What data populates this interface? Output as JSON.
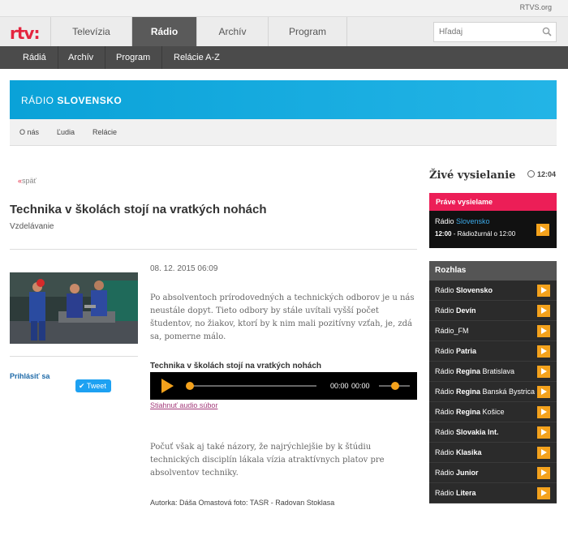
{
  "header": {
    "rtvs_link": "RTVS.org",
    "logo": "rtv:",
    "tabs": [
      {
        "label": "Televízia",
        "active": false
      },
      {
        "label": "Rádio",
        "active": true
      },
      {
        "label": "Archív",
        "active": false
      },
      {
        "label": "Program",
        "active": false
      }
    ],
    "search_placeholder": "Hľadaj"
  },
  "subnav": [
    "Rádiá",
    "Archív",
    "Program",
    "Relácie A-Z"
  ],
  "station_banner": {
    "prefix": "RÁDIO",
    "name": "SLOVENSKO"
  },
  "station_nav": [
    "O nás",
    "Ľudia",
    "Relácie"
  ],
  "article": {
    "back_arrow": "«",
    "back_label": "späť",
    "title": "Technika v školách stojí na vratkých nohách",
    "category": "Vzdelávanie",
    "date": "08. 12. 2015 06:09",
    "paragraph1": "Po absolventoch prírodovedných a technických odborov je u nás neustále dopyt. Tieto odbory by stále uvítali vyšší počet študentov, no žiakov, ktorí by k nim mali pozitívny vzťah, je, zdá sa, pomerne málo.",
    "audio_title": "Technika v školách stojí na vratkých nohách",
    "audio_time_current": "00:00",
    "audio_time_total": "00:00",
    "download_label": "Stiahnuť audio súbor",
    "paragraph2": "Počuť však aj také názory, že najrýchlejšie by k štúdiu technických disciplín lákala vízia atraktívnych platov pre absolventov techniky.",
    "author": "Autorka: Dáša Omastová foto: TASR - Radovan Stoklasa"
  },
  "social": {
    "login_label": "Prihlásiť sa",
    "tweet_label": "Tweet"
  },
  "sidebar": {
    "live_title": "Živé vysielanie",
    "clock_time": "12:04",
    "now_playing_head": "Práve vysielame",
    "now_station_prefix": "Rádio",
    "now_station_name": "Slovensko",
    "now_time": "12:00",
    "now_show": " - Rádiožurnál o 12:00",
    "rozhlas_head": "Rozhlas",
    "stations": [
      {
        "prefix": "Rádio ",
        "name": "Slovensko",
        "suffix": ""
      },
      {
        "prefix": "Rádio ",
        "name": "Devín",
        "suffix": ""
      },
      {
        "prefix": "Rádio_FM",
        "name": "",
        "suffix": ""
      },
      {
        "prefix": "Rádio ",
        "name": "Patria",
        "suffix": ""
      },
      {
        "prefix": "Rádio ",
        "name": "Regina",
        "suffix": " Bratislava"
      },
      {
        "prefix": "Rádio ",
        "name": "Regina",
        "suffix": " Banská Bystrica"
      },
      {
        "prefix": "Rádio ",
        "name": "Regina",
        "suffix": " Košice"
      },
      {
        "prefix": "Rádio ",
        "name": "Slovakia Int.",
        "suffix": ""
      },
      {
        "prefix": "Rádio ",
        "name": "Klasika",
        "suffix": ""
      },
      {
        "prefix": "Rádio ",
        "name": "Junior",
        "suffix": ""
      },
      {
        "prefix": "Rádio ",
        "name": "Litera",
        "suffix": ""
      }
    ]
  },
  "colors": {
    "brand_red": "#e4253f",
    "accent_orange": "#f4a21c",
    "banner_blue": "#0aa2d8",
    "live_pink": "#ec1e57"
  }
}
